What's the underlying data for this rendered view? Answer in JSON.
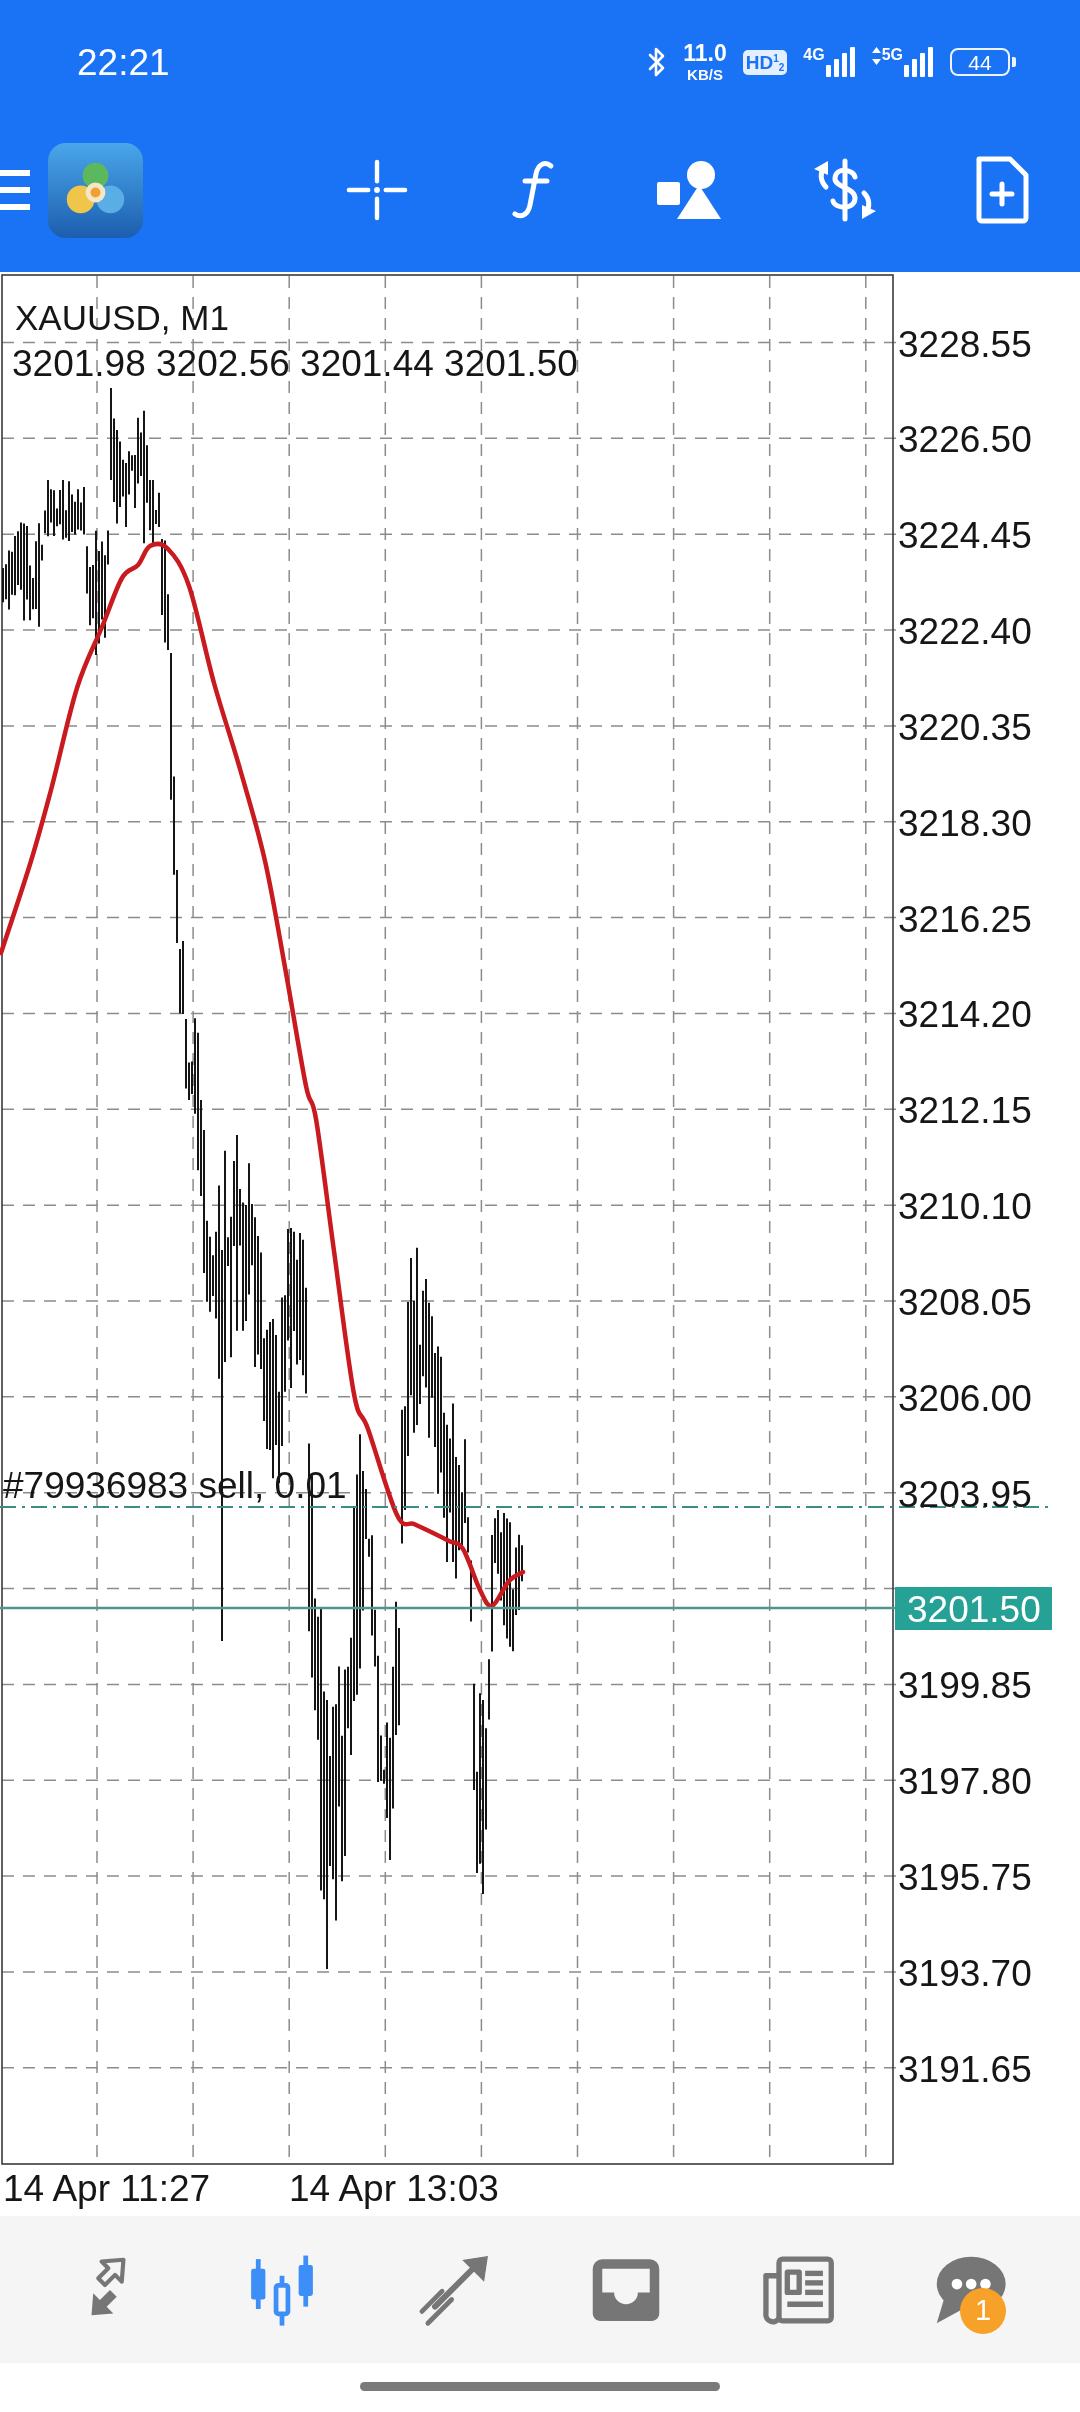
{
  "status_bar": {
    "time": "22:21",
    "network_speed": "11.0",
    "speed_unit": "KB/S",
    "hd_badge": "HD$^{1}$$_{2}$",
    "sim1_network": "4G",
    "sim2_network": "5G",
    "battery": "44"
  },
  "chart": {
    "symbol": "XAUUSD, M1",
    "ohlc": "3201.98 3202.56 3201.44 3201.50",
    "order_label": "#79936983 sell, 0.01",
    "price_axis": {
      "labels_above_current_price": [
        "3228.55",
        "3226.50",
        "3224.45",
        "3222.40",
        "3220.35",
        "3218.30",
        "3216.25",
        "3214.20",
        "3212.15",
        "3210.10",
        "3208.05",
        "3206.00",
        "3203.95"
      ],
      "current_price": "3201.50",
      "labels_below_current_price": [
        "3199.85",
        "3197.80",
        "3195.75",
        "3193.70",
        "3191.65"
      ]
    },
    "time_axis": {
      "labels": [
        "14 Apr 11:27",
        "14 Apr 13:03"
      ]
    }
  },
  "bottom_nav": {
    "tabs": [
      {
        "selected": false
      },
      {
        "selected": true
      },
      {
        "selected": false
      },
      {
        "selected": false
      },
      {
        "selected": false
      },
      {
        "selected": false,
        "badge": "1"
      }
    ]
  }
}
